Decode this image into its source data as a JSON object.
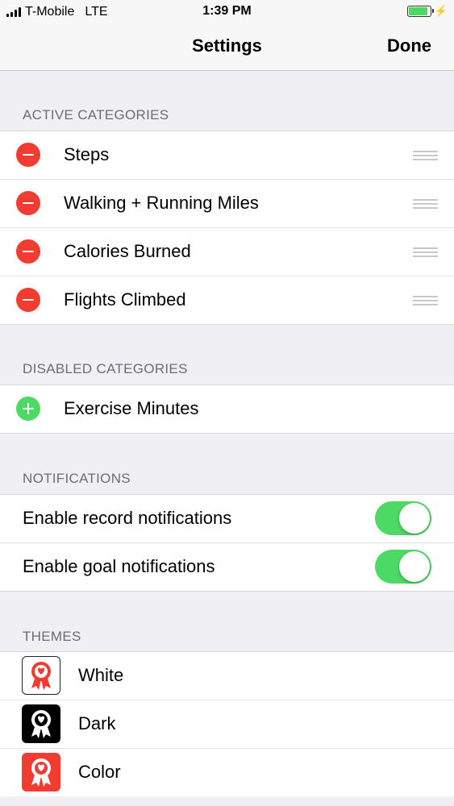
{
  "status_bar": {
    "carrier": "T-Mobile",
    "network": "LTE",
    "time": "1:39 PM",
    "battery_level": 0.9
  },
  "nav": {
    "title": "Settings",
    "done_label": "Done"
  },
  "active_categories": {
    "header": "ACTIVE CATEGORIES",
    "items": [
      {
        "label": "Steps"
      },
      {
        "label": "Walking + Running Miles"
      },
      {
        "label": "Calories Burned"
      },
      {
        "label": "Flights Climbed"
      }
    ]
  },
  "disabled_categories": {
    "header": "DISABLED CATEGORIES",
    "items": [
      {
        "label": "Exercise Minutes"
      }
    ]
  },
  "notifications": {
    "header": "NOTIFICATIONS",
    "items": [
      {
        "label": "Enable record notifications",
        "enabled": true
      },
      {
        "label": "Enable goal notifications",
        "enabled": true
      }
    ]
  },
  "themes": {
    "header": "THEMES",
    "items": [
      {
        "label": "White",
        "icon": "ribbon-award-icon"
      },
      {
        "label": "Dark",
        "icon": "ribbon-award-icon"
      },
      {
        "label": "Color",
        "icon": "ribbon-award-icon"
      }
    ]
  },
  "colors": {
    "remove": "#f23c31",
    "add": "#4cd964",
    "toggle_on": "#4cd964",
    "theme_color": "#f23c31"
  }
}
